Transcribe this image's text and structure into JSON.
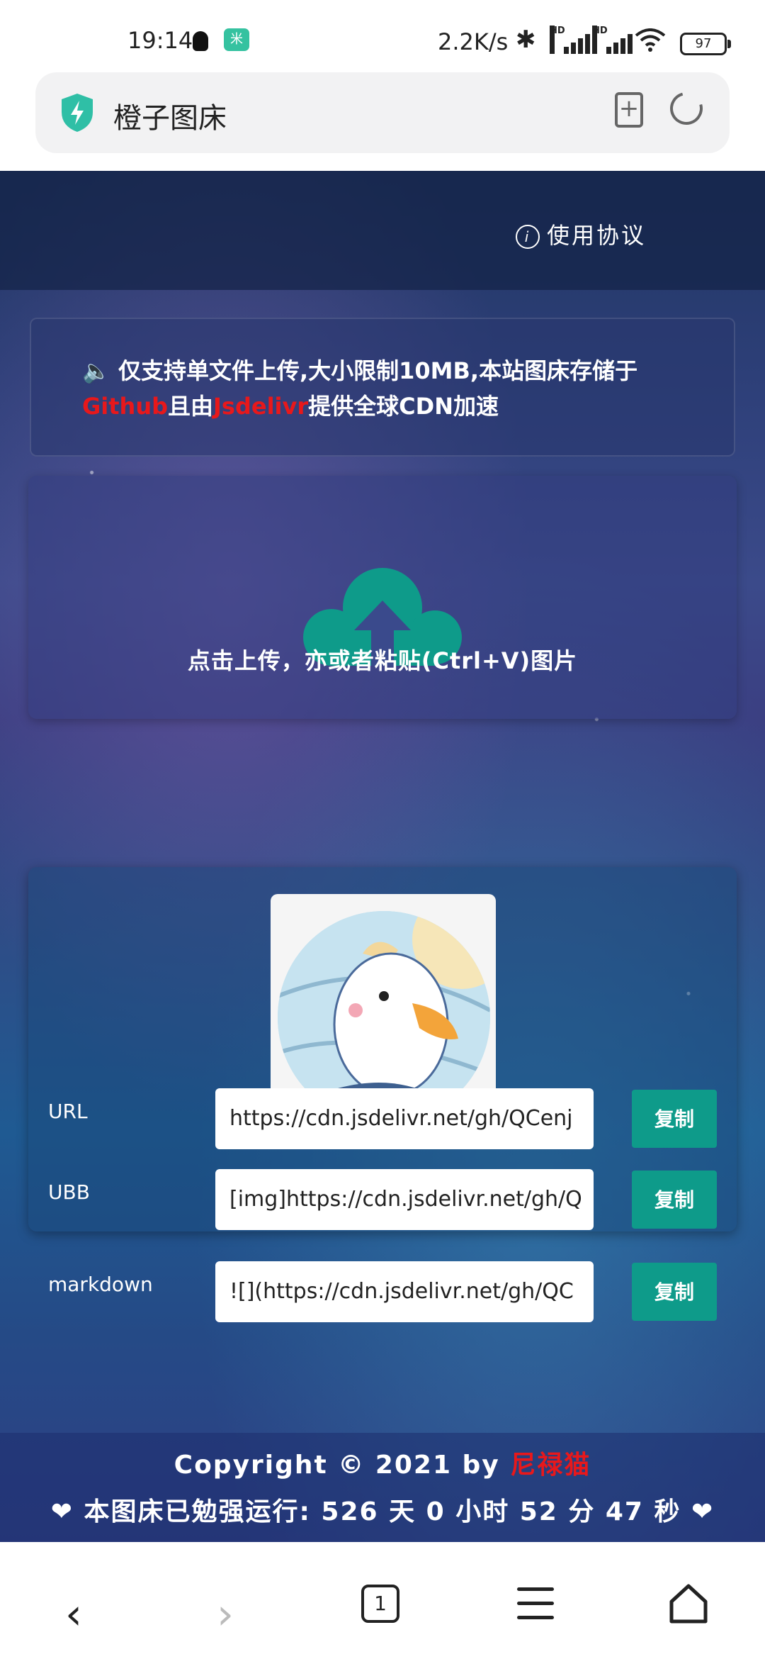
{
  "status_bar": {
    "time": "19:14",
    "app_icon_text": "米",
    "net_speed": "2.2K/s",
    "bluetooth_glyph": "✱",
    "hd_label": "HD",
    "battery": "97"
  },
  "address_bar": {
    "title": "橙子图床",
    "bookmark_glyph": "+"
  },
  "header": {
    "agreement_icon": "i",
    "agreement_label": "使用协议"
  },
  "notice": {
    "icon": "🔈",
    "part1": " 仅支持单文件上传,大小限制10MB,本站图床存储于",
    "github": "Github",
    "part2": "且由",
    "jsdelivr": "Jsdelivr",
    "part3": "提供全球CDN加速"
  },
  "upload": {
    "text": "点击上传，亦或者粘贴(Ctrl+V)图片"
  },
  "result": {
    "rows": [
      {
        "label": "URL",
        "value": "https://cdn.jsdelivr.net/gh/QCenj",
        "button": "复制"
      },
      {
        "label": "UBB",
        "value": "[img]https://cdn.jsdelivr.net/gh/Q",
        "button": "复制"
      },
      {
        "label": "markdown",
        "value": "![](https://cdn.jsdelivr.net/gh/QC",
        "button": "复制"
      }
    ]
  },
  "footer": {
    "copyright_prefix": "Copyright © 2021 by ",
    "author": "尼禄猫",
    "runtime": "❤ 本图床已勉强运行: 526 天 0 小时 52 分 47 秒 ❤"
  },
  "nav": {
    "back_glyph": "‹",
    "forward_glyph": "›",
    "tab_count": "1"
  },
  "colors": {
    "accent": "#0e9b8a",
    "link_red": "#e8181b"
  }
}
